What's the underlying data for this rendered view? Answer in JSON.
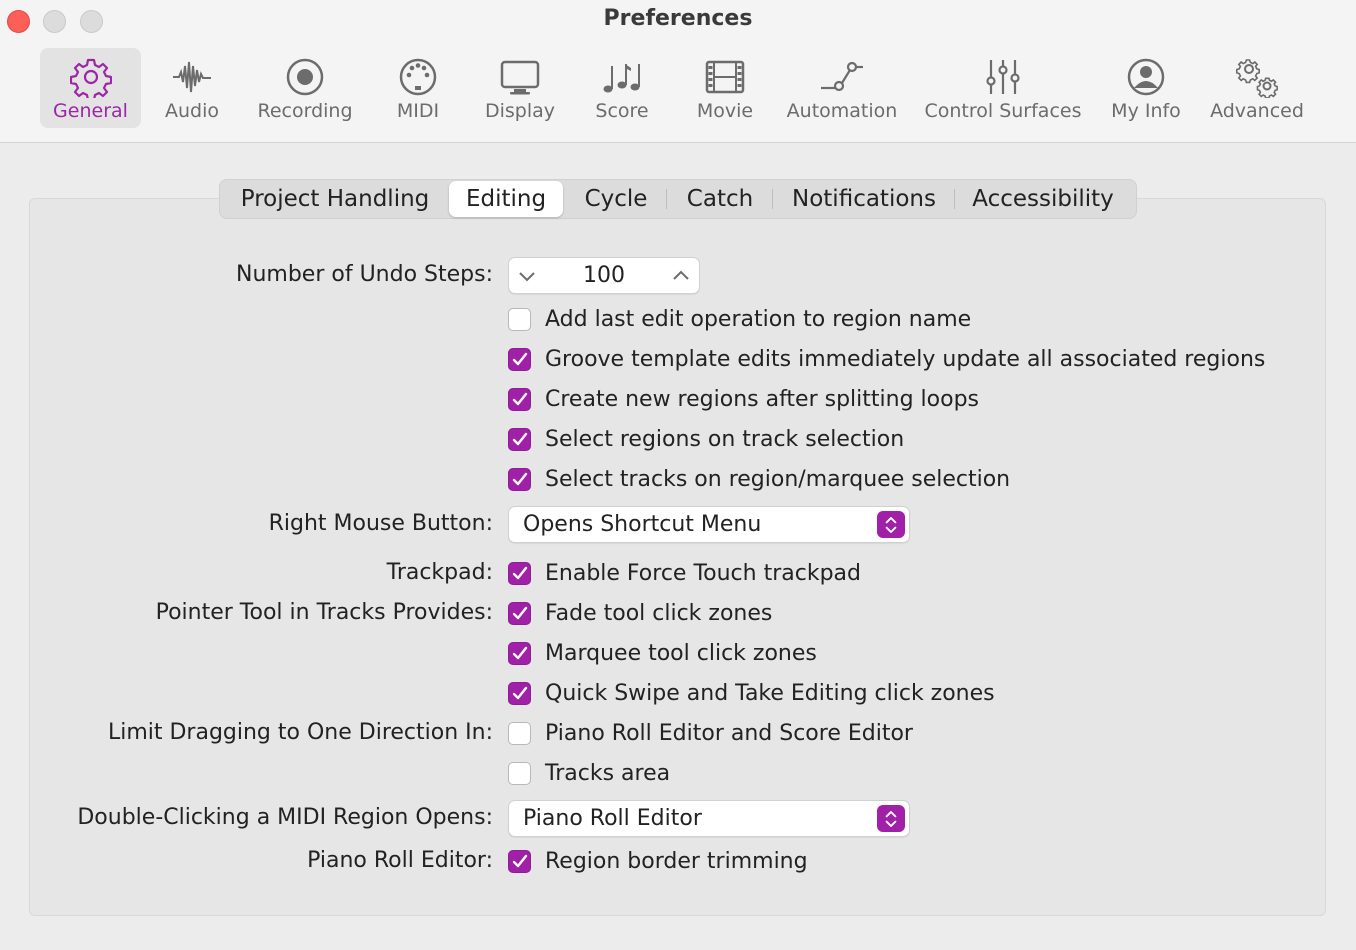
{
  "window": {
    "title": "Preferences"
  },
  "toolbar": {
    "items": [
      {
        "label": "General",
        "icon": "gear-icon",
        "active": true
      },
      {
        "label": "Audio",
        "icon": "waveform-icon"
      },
      {
        "label": "Recording",
        "icon": "record-icon"
      },
      {
        "label": "MIDI",
        "icon": "midi-port-icon"
      },
      {
        "label": "Display",
        "icon": "monitor-icon"
      },
      {
        "label": "Score",
        "icon": "music-notes-icon"
      },
      {
        "label": "Movie",
        "icon": "film-icon"
      },
      {
        "label": "Automation",
        "icon": "automation-curve-icon"
      },
      {
        "label": "Control Surfaces",
        "icon": "sliders-icon"
      },
      {
        "label": "My Info",
        "icon": "user-circle-icon"
      },
      {
        "label": "Advanced",
        "icon": "gears-icon"
      }
    ],
    "accent_color": "#9b27a5"
  },
  "tabs": {
    "items": [
      "Project Handling",
      "Editing",
      "Cycle",
      "Catch",
      "Notifications",
      "Accessibility"
    ],
    "selected": "Editing"
  },
  "editing": {
    "undo_steps_label": "Number of Undo Steps:",
    "undo_steps_value": "100",
    "checkboxes_top": [
      {
        "label": "Add last edit operation to region name",
        "checked": false
      },
      {
        "label": "Groove template edits immediately update all associated regions",
        "checked": true
      },
      {
        "label": "Create new regions after splitting loops",
        "checked": true
      },
      {
        "label": "Select regions on track selection",
        "checked": true
      },
      {
        "label": "Select tracks on region/marquee selection",
        "checked": true
      }
    ],
    "right_mouse_label": "Right Mouse Button:",
    "right_mouse_value": "Opens Shortcut Menu",
    "trackpad_label": "Trackpad:",
    "trackpad_option": {
      "label": "Enable Force Touch trackpad",
      "checked": true
    },
    "pointer_label": "Pointer Tool in Tracks Provides:",
    "pointer_options": [
      {
        "label": "Fade tool click zones",
        "checked": true
      },
      {
        "label": "Marquee tool click zones",
        "checked": true
      },
      {
        "label": "Quick Swipe and Take Editing click zones",
        "checked": true
      }
    ],
    "limit_label": "Limit Dragging to One Direction In:",
    "limit_options": [
      {
        "label": "Piano Roll Editor and Score Editor",
        "checked": false
      },
      {
        "label": "Tracks area",
        "checked": false
      }
    ],
    "double_click_label": "Double-Clicking a MIDI Region Opens:",
    "double_click_value": "Piano Roll Editor",
    "piano_roll_label": "Piano Roll Editor:",
    "piano_roll_option": {
      "label": "Region border trimming",
      "checked": true
    }
  },
  "colors": {
    "checkbox_checked": "#a020a8",
    "close_button": "#fe5f57"
  }
}
